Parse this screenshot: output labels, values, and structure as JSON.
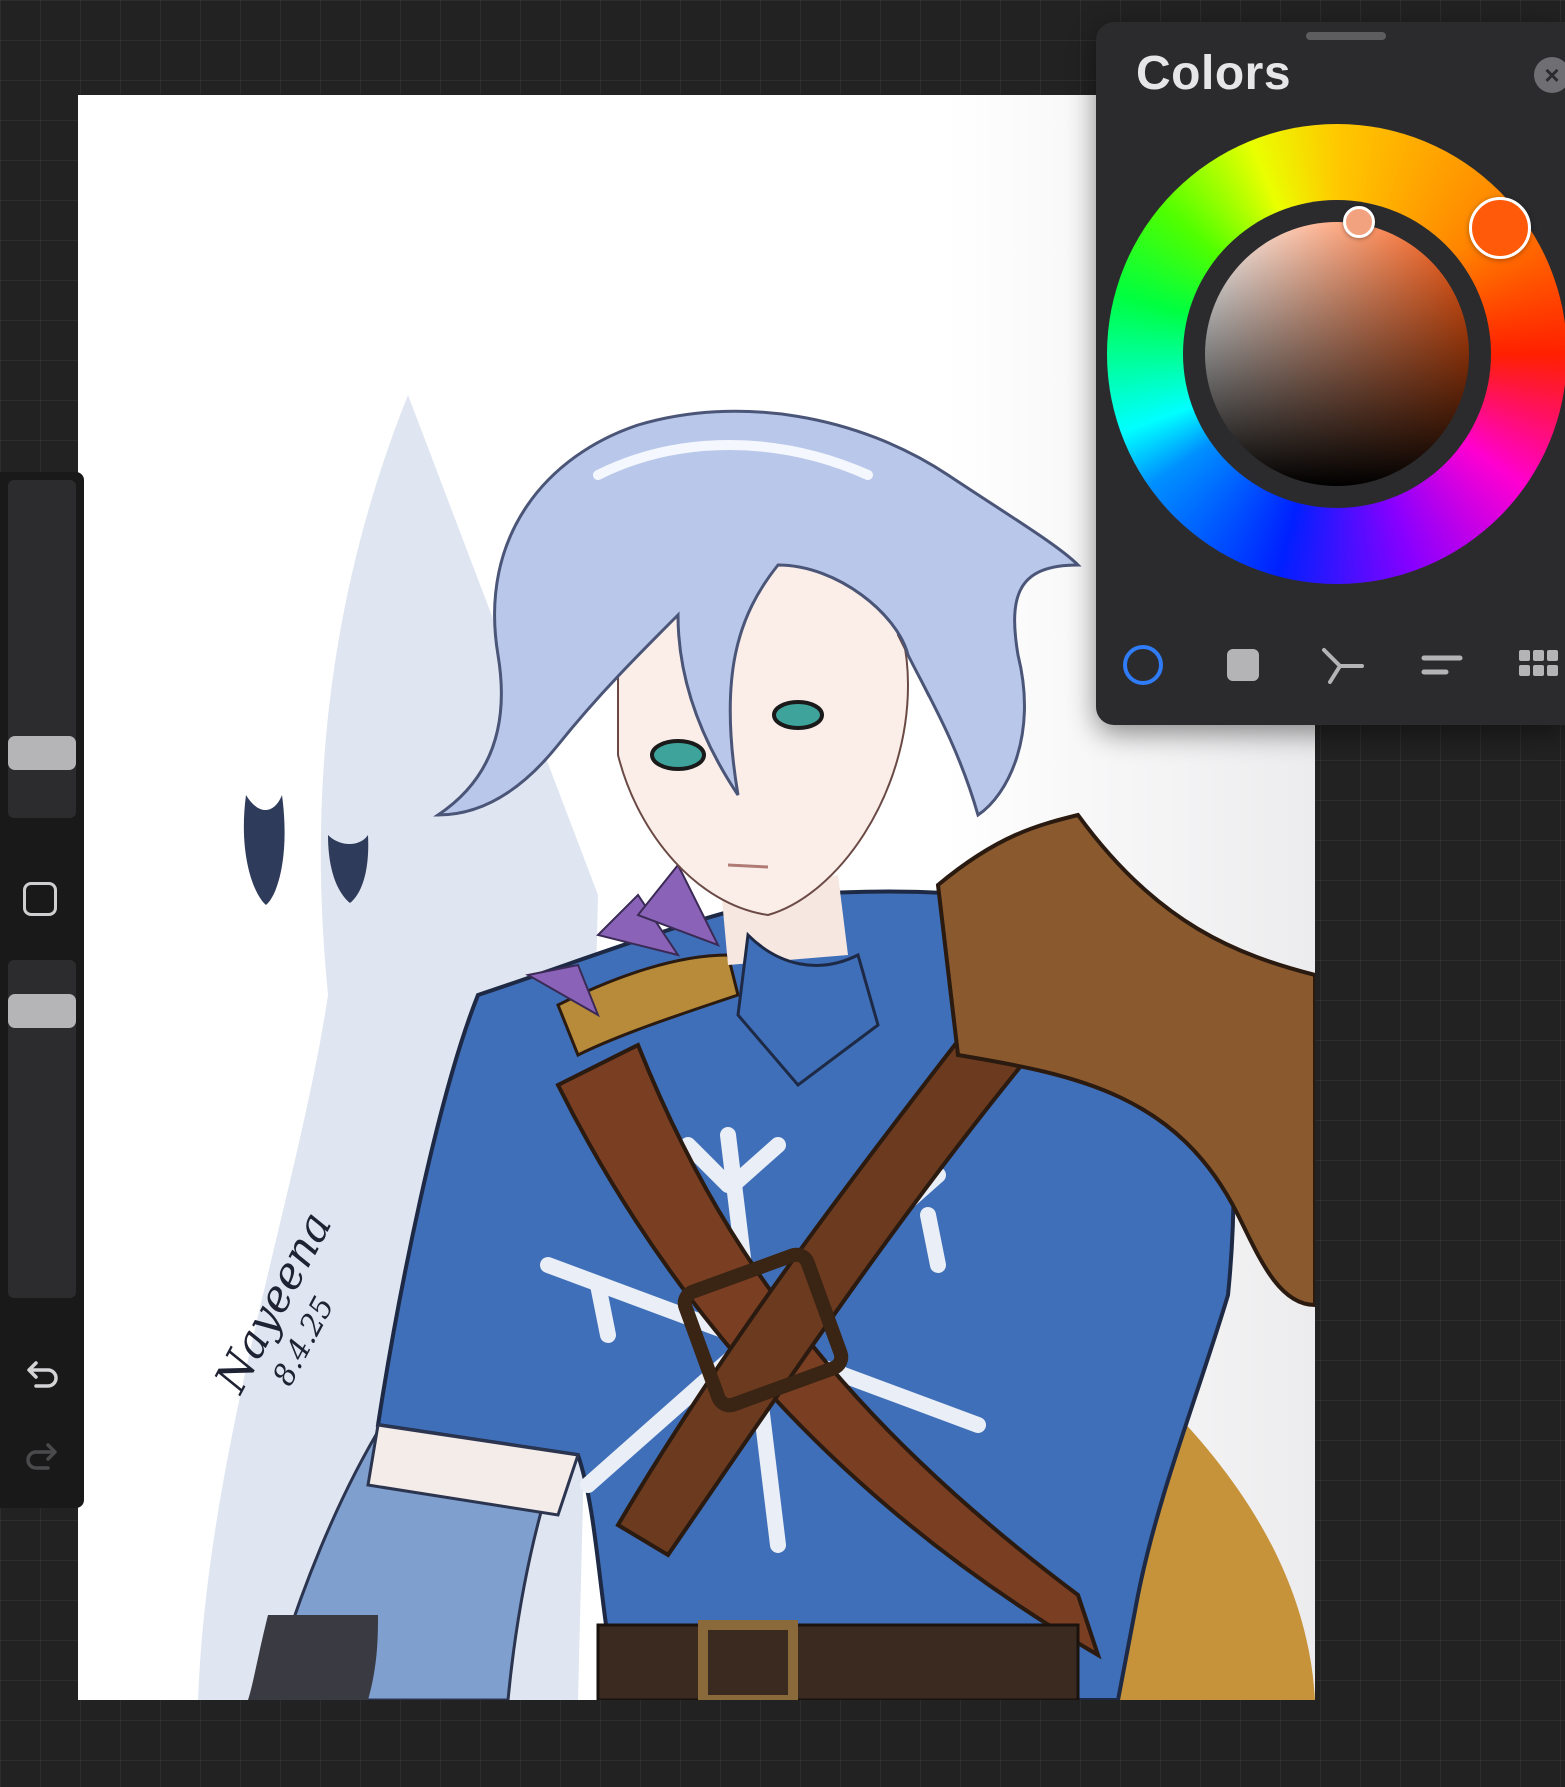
{
  "colors_panel": {
    "title": "Colors",
    "close_glyph": "×",
    "current_color": "#ff5a0a",
    "saturation_preview": "#f2a27e",
    "modes": [
      {
        "name": "disc",
        "icon": "ring-icon",
        "selected": true
      },
      {
        "name": "classic",
        "icon": "square-icon",
        "selected": false
      },
      {
        "name": "harmony",
        "icon": "harmony-icon",
        "selected": false
      },
      {
        "name": "value",
        "icon": "sliders-icon",
        "selected": false
      },
      {
        "name": "palettes",
        "icon": "grid-icon",
        "selected": false
      }
    ]
  },
  "sidebar": {
    "brush_size_level": 0.15,
    "brush_opacity_level": 0.1,
    "icons": [
      "modify-square-icon",
      "undo-icon",
      "redo-icon"
    ]
  },
  "artwork": {
    "signature_lines": [
      "Nayeena",
      "8.4.25"
    ]
  }
}
